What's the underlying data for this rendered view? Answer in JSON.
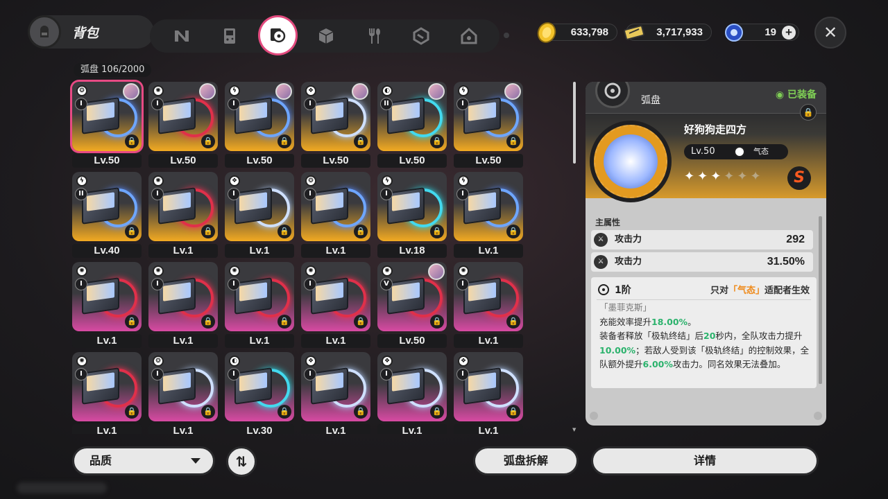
{
  "header": {
    "title": "背包",
    "tabs": [
      {
        "icon": "n-logo-icon",
        "active": false
      },
      {
        "icon": "gameboy-icon",
        "active": false
      },
      {
        "icon": "disc-icon",
        "active": true
      },
      {
        "icon": "cube-icon",
        "active": false
      },
      {
        "icon": "fork-spoon-icon",
        "active": false
      },
      {
        "icon": "package-icon",
        "active": false
      },
      {
        "icon": "house-icon",
        "active": false
      }
    ],
    "currencies": {
      "coin": "633,798",
      "ticket": "3,717,933",
      "energy": "19"
    }
  },
  "grid": {
    "label": "弧盘",
    "count": "106/2000",
    "items": [
      {
        "level": "Lv.50",
        "rank": "I",
        "attr": "❂",
        "style": "gold",
        "disc": "blue",
        "avatar": true,
        "selected": true
      },
      {
        "level": "Lv.50",
        "rank": "I",
        "attr": "✺",
        "style": "gold",
        "disc": "red",
        "avatar": true
      },
      {
        "level": "Lv.50",
        "rank": "I",
        "attr": "ϟ",
        "style": "gold",
        "disc": "blue",
        "avatar": true
      },
      {
        "level": "Lv.50",
        "rank": "I",
        "attr": "❖",
        "style": "gold",
        "disc": "white",
        "avatar": true
      },
      {
        "level": "Lv.50",
        "rank": "II",
        "attr": "◐",
        "style": "gold",
        "disc": "cyan",
        "avatar": true
      },
      {
        "level": "Lv.50",
        "rank": "I",
        "attr": "ϟ",
        "style": "gold",
        "disc": "blue",
        "avatar": true
      },
      {
        "level": "Lv.40",
        "rank": "II",
        "attr": "ϟ",
        "style": "gold",
        "disc": "blue"
      },
      {
        "level": "Lv.1",
        "rank": "I",
        "attr": "✺",
        "style": "gold",
        "disc": "red"
      },
      {
        "level": "Lv.1",
        "rank": "I",
        "attr": "❖",
        "style": "gold",
        "disc": "white"
      },
      {
        "level": "Lv.1",
        "rank": "I",
        "attr": "❂",
        "style": "gold",
        "disc": "blue"
      },
      {
        "level": "Lv.18",
        "rank": "I",
        "attr": "ϟ",
        "style": "gold",
        "disc": "cyan"
      },
      {
        "level": "Lv.1",
        "rank": "I",
        "attr": "ϟ",
        "style": "gold",
        "disc": "blue"
      },
      {
        "level": "Lv.1",
        "rank": "I",
        "attr": "✺",
        "style": "pink",
        "disc": "red"
      },
      {
        "level": "Lv.1",
        "rank": "I",
        "attr": "✺",
        "style": "pink",
        "disc": "red"
      },
      {
        "level": "Lv.1",
        "rank": "I",
        "attr": "✺",
        "style": "pink",
        "disc": "red"
      },
      {
        "level": "Lv.1",
        "rank": "I",
        "attr": "✺",
        "style": "pink",
        "disc": "red"
      },
      {
        "level": "Lv.50",
        "rank": "V",
        "attr": "✺",
        "style": "pink",
        "disc": "red",
        "avatar": true
      },
      {
        "level": "Lv.1",
        "rank": "I",
        "attr": "✺",
        "style": "pink",
        "disc": "red"
      },
      {
        "level": "Lv.1",
        "rank": "I",
        "attr": "✺",
        "style": "pink",
        "disc": "red"
      },
      {
        "level": "Lv.1",
        "rank": "I",
        "attr": "❂",
        "style": "pink",
        "disc": "white"
      },
      {
        "level": "Lv.30",
        "rank": "I",
        "attr": "◐",
        "style": "pink",
        "disc": "cyan"
      },
      {
        "level": "Lv.1",
        "rank": "I",
        "attr": "❖",
        "style": "pink",
        "disc": "white"
      },
      {
        "level": "Lv.1",
        "rank": "I",
        "attr": "❖",
        "style": "pink",
        "disc": "white"
      },
      {
        "level": "Lv.1",
        "rank": "I",
        "attr": "❖",
        "style": "pink",
        "disc": "white"
      }
    ]
  },
  "detail": {
    "type_name": "弧盘",
    "equipped": "◉ 已装备",
    "disc_name": "好狗狗走四方",
    "level": "Lv.50",
    "attribute": "气态",
    "stars_on": 3,
    "stars_total": 6,
    "rarity": "S",
    "main_attr_title": "主属性",
    "stats": [
      {
        "name": "攻击力",
        "value": "292"
      },
      {
        "name": "攻击力",
        "value": "31.50%"
      }
    ],
    "effect": {
      "tier": "1阶",
      "cond_prefix": "只对",
      "cond_attr": "「气态」",
      "cond_suffix": "适配者生效",
      "set_name": "「墨菲克斯」",
      "line1_a": "充能效率提升",
      "line1_v": "18.00%",
      "line1_b": "。",
      "line2_a": "装备者释放「极轨终结」后",
      "line2_v": "20",
      "line2_b": "秒内，全队攻击力提升",
      "line2_v2": "10.00%",
      "line2_c": "；若敌人受到该「极轨终结」的控制效果，全队额外提升",
      "line2_v3": "6.00%",
      "line2_d": "攻击力。同名效果无法叠加。"
    }
  },
  "bottom": {
    "filter_label": "品质",
    "sort_label": "⇅",
    "dismantle_label": "弧盘拆解",
    "details_label": "详情"
  },
  "colors": {
    "accent_pink": "#e84a84",
    "gold": "#f2aa22",
    "purple_pink": "#d84aa3",
    "green": "#2bb26c",
    "orange": "#ef8a1a"
  }
}
